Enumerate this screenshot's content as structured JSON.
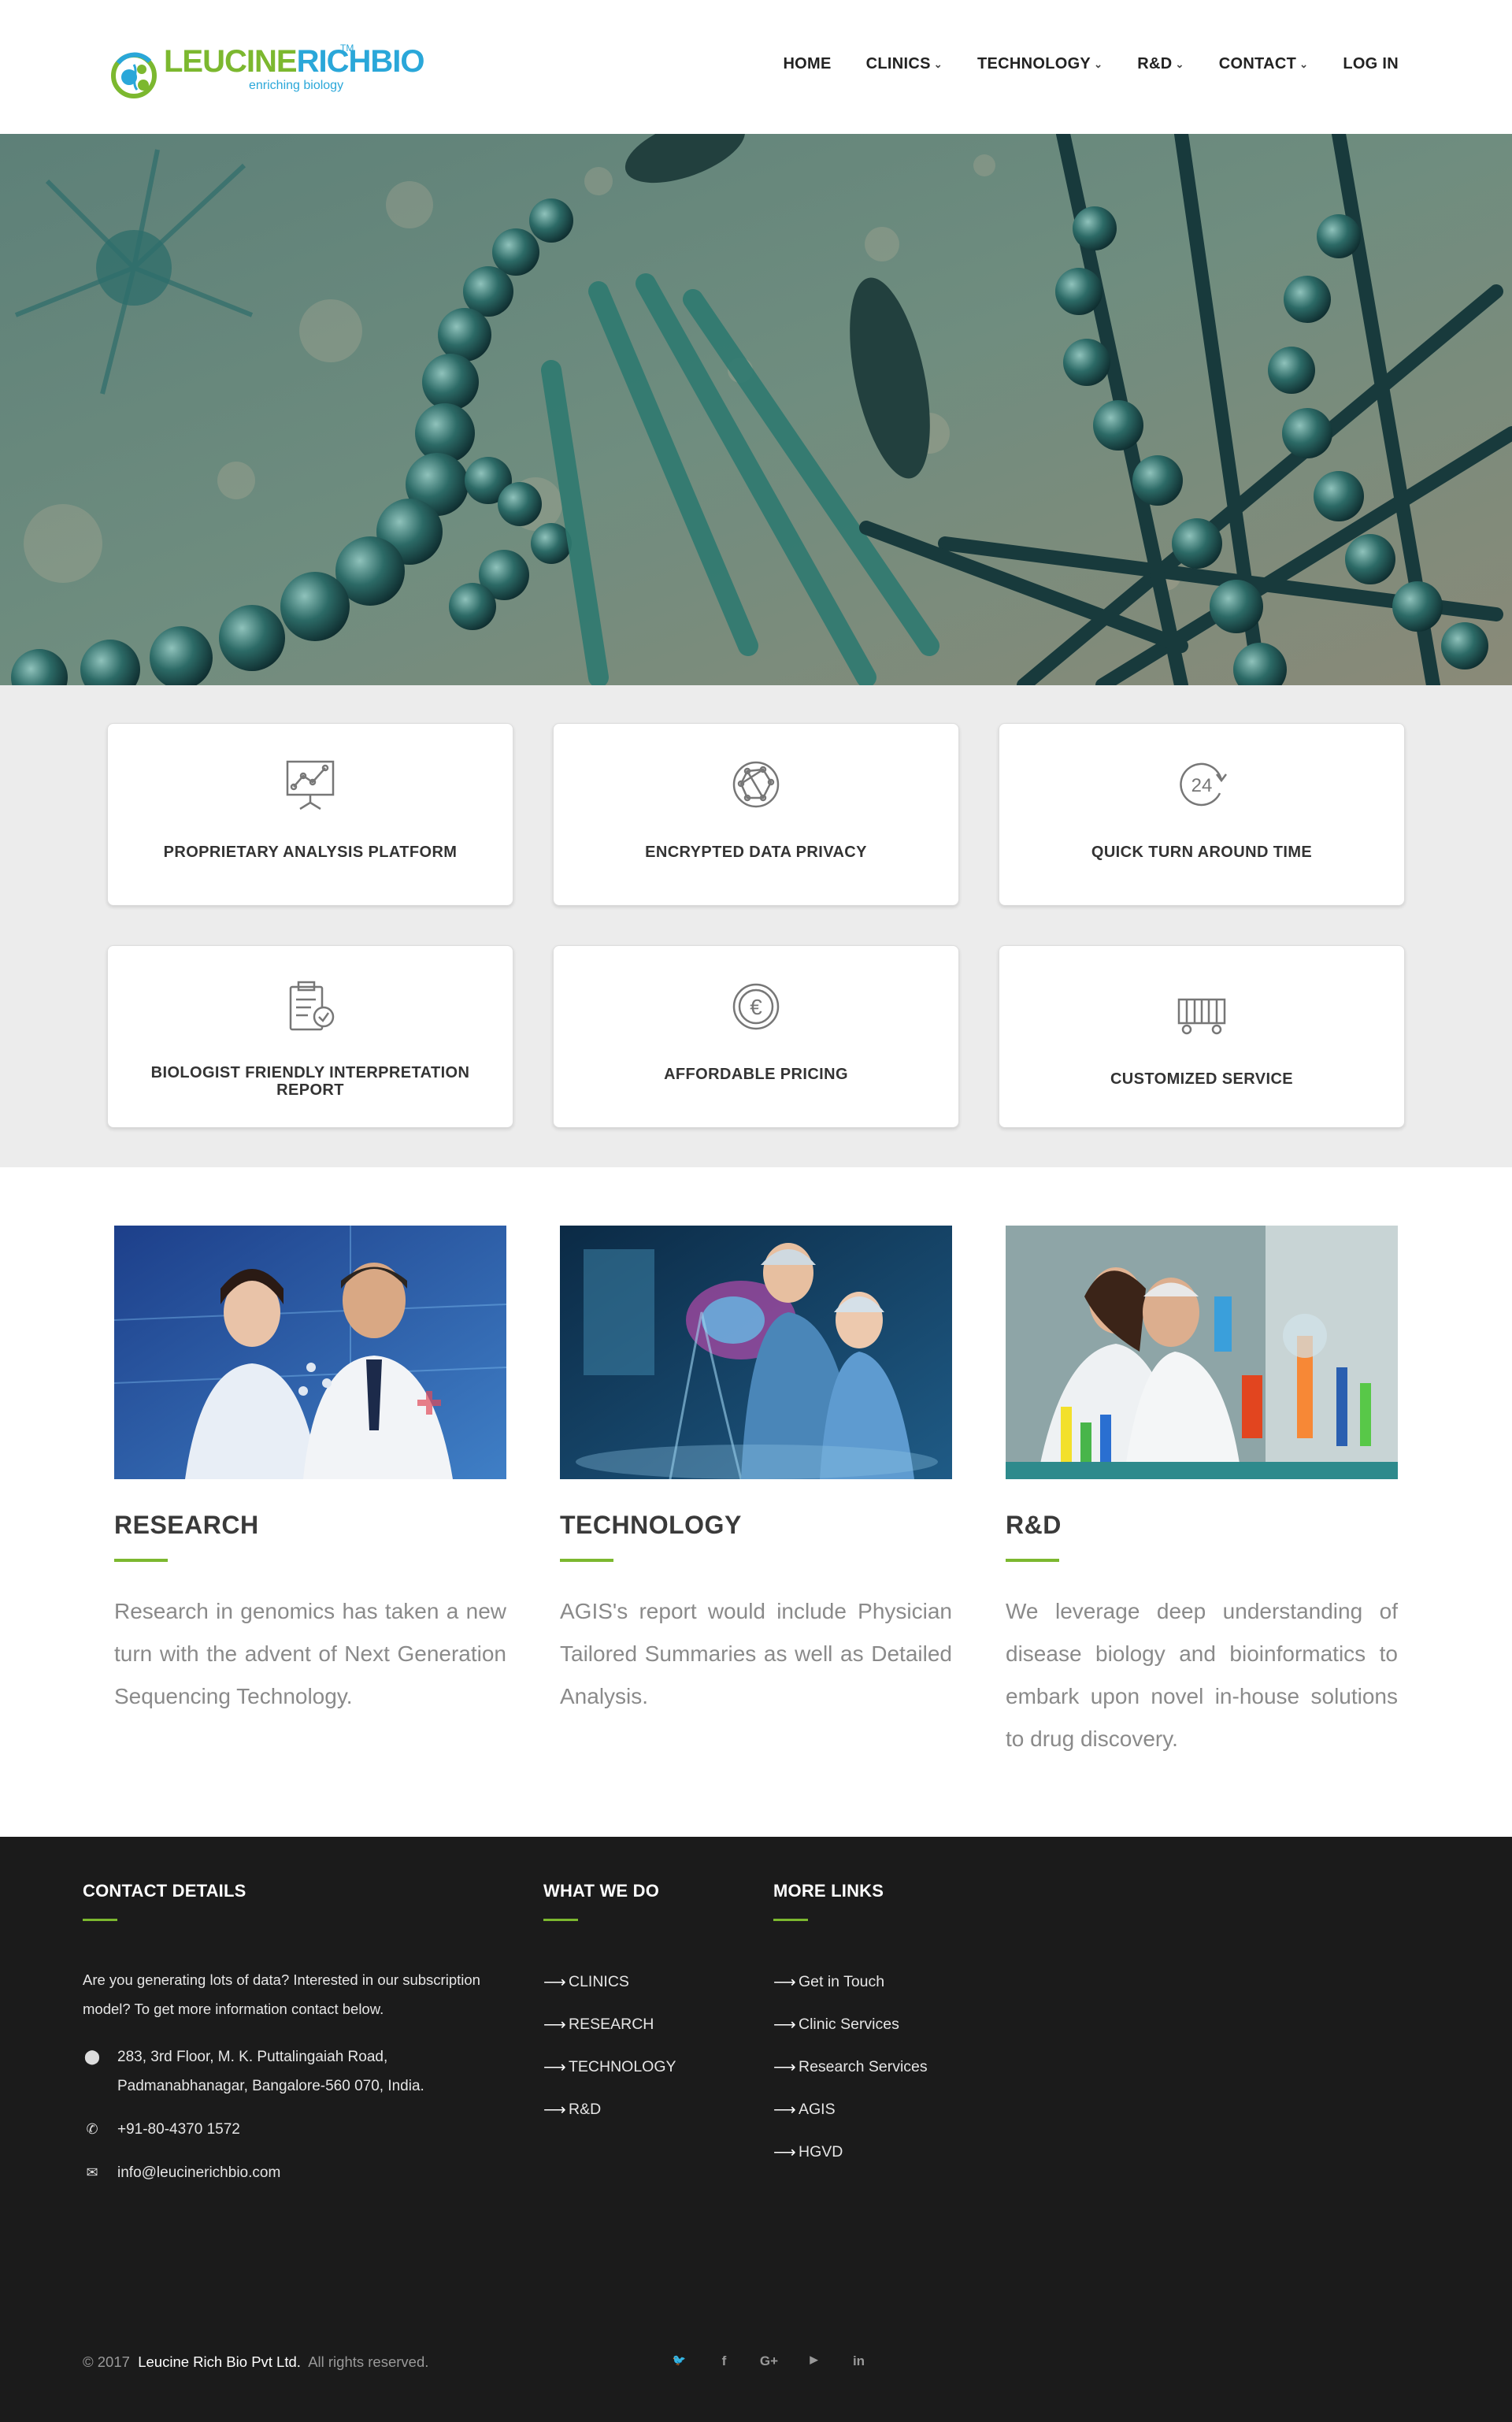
{
  "brand": {
    "name_part1": "LEUCINE",
    "name_part2": "RICH",
    "name_part3": "BIO",
    "trademark": "TM",
    "tagline": "enriching biology",
    "color_green": "#7cb82f",
    "color_blue": "#2aa7d9"
  },
  "nav": {
    "items": [
      {
        "label": "HOME",
        "dropdown": false
      },
      {
        "label": "CLINICS",
        "dropdown": true
      },
      {
        "label": "TECHNOLOGY",
        "dropdown": true
      },
      {
        "label": "R&D",
        "dropdown": true
      },
      {
        "label": "CONTACT",
        "dropdown": true
      },
      {
        "label": "LOG IN",
        "dropdown": false
      }
    ],
    "chevron": "⌄"
  },
  "features": [
    {
      "title": "PROPRIETARY ANALYSIS PLATFORM",
      "icon": "presentation-chart-icon"
    },
    {
      "title": "ENCRYPTED DATA PRIVACY",
      "icon": "network-globe-icon"
    },
    {
      "title": "QUICK TURN AROUND TIME",
      "icon": "24-hours-icon"
    },
    {
      "title": "BIOLOGIST FRIENDLY INTERPRETATION REPORT",
      "icon": "clipboard-check-icon"
    },
    {
      "title": "AFFORDABLE PRICING",
      "icon": "euro-coin-icon"
    },
    {
      "title": "CUSTOMIZED SERVICE",
      "icon": "cart-icon"
    }
  ],
  "icon_text": {
    "hours": "24",
    "euro": "€"
  },
  "services": [
    {
      "title": "RESEARCH",
      "text": "Research in genomics has taken a new turn with the advent of Next Generation Sequencing Technology."
    },
    {
      "title": "TECHNOLOGY",
      "text": "AGIS's report would include Physician Tailored Summaries as well as Detailed Analysis."
    },
    {
      "title": "R&D",
      "text": "We leverage deep understanding of disease biology and bioinformatics to embark upon novel in-house solutions to drug discovery."
    }
  ],
  "footer": {
    "contact": {
      "heading": "CONTACT DETAILS",
      "intro": "Are you generating lots of data? Interested in our subscription model? To get more information contact below.",
      "address": "283, 3rd Floor, M. K. Puttalingaiah Road, Padmanabhanagar, Bangalore-560 070, India.",
      "phone": "+91-80-4370 1572",
      "email": "info@leucinerichbio.com"
    },
    "what_we_do": {
      "heading": "WHAT WE DO",
      "items": [
        "CLINICS",
        "RESEARCH",
        "TECHNOLOGY",
        "R&D"
      ]
    },
    "more_links": {
      "heading": "MORE LINKS",
      "items": [
        "Get in Touch",
        "Clinic Services",
        "Research Services",
        "AGIS",
        "HGVD"
      ]
    },
    "arrow": "⟶",
    "copyright_prefix": "© 2017",
    "company": "Leucine Rich Bio Pvt Ltd.",
    "rights": "All rights reserved.",
    "social": [
      {
        "name": "twitter-icon",
        "glyph": "🐦"
      },
      {
        "name": "facebook-icon",
        "glyph": "f"
      },
      {
        "name": "google-plus-icon",
        "glyph": "G+"
      },
      {
        "name": "youtube-icon",
        "glyph": "▶"
      },
      {
        "name": "linkedin-icon",
        "glyph": "in"
      }
    ]
  }
}
